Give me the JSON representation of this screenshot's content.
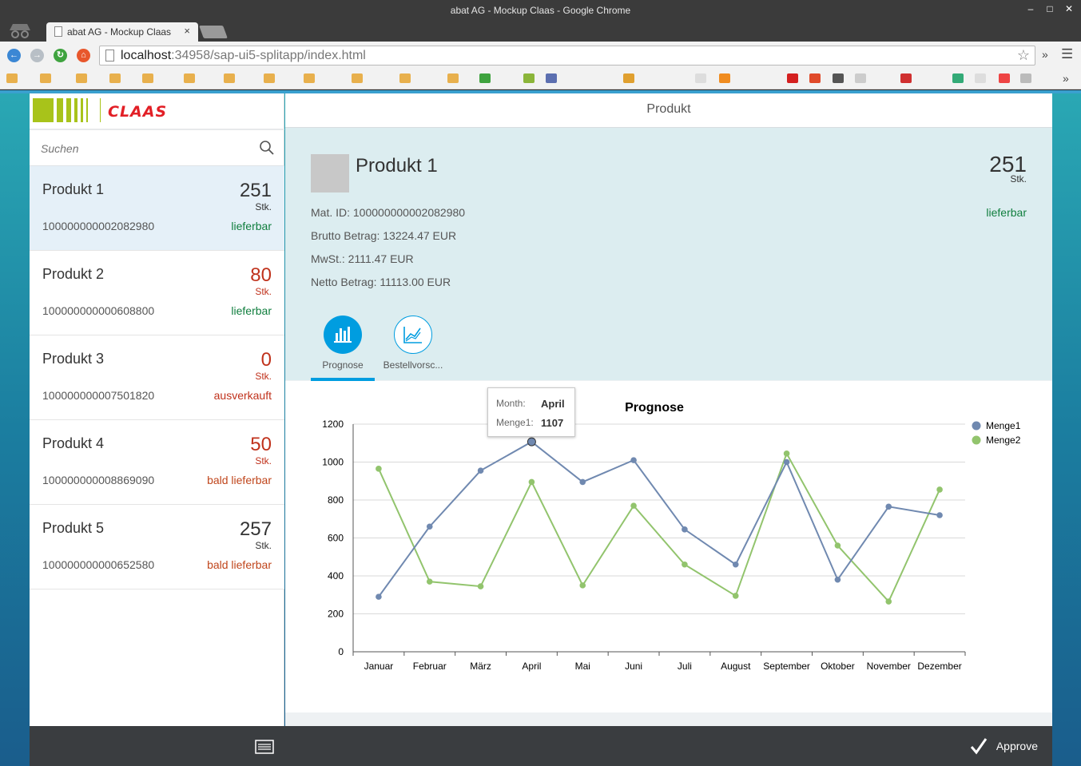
{
  "window": {
    "title": "abat AG - Mockup Claas - Google Chrome",
    "tab_label": "abat AG - Mockup Claas",
    "tab_close": "×"
  },
  "browser": {
    "url_host": "localhost",
    "url_rest": ":34958/sap-ui5-splitapp/index.html",
    "menu_more": "»",
    "bookmarks_more": "»"
  },
  "master": {
    "logo_text": "CLAAS",
    "search_placeholder": "Suchen",
    "items": [
      {
        "name": "Produkt 1",
        "count": "251",
        "unit": "Stk.",
        "id": "100000000002082980",
        "status": "lieferbar",
        "status_color": "#107e3e",
        "count_color": "#333333"
      },
      {
        "name": "Produkt 2",
        "count": "80",
        "unit": "Stk.",
        "id": "100000000000608800",
        "status": "lieferbar",
        "status_color": "#107e3e",
        "count_color": "#c0321c"
      },
      {
        "name": "Produkt 3",
        "count": "0",
        "unit": "Stk.",
        "id": "100000000007501820",
        "status": "ausverkauft",
        "status_color": "#c0321c",
        "count_color": "#c0321c"
      },
      {
        "name": "Produkt 4",
        "count": "50",
        "unit": "Stk.",
        "id": "100000000008869090",
        "status": "bald lieferbar",
        "status_color": "#c0461c",
        "count_color": "#c0321c"
      },
      {
        "name": "Produkt 5",
        "count": "257",
        "unit": "Stk.",
        "id": "100000000000652580",
        "status": "bald lieferbar",
        "status_color": "#c0461c",
        "count_color": "#333333"
      }
    ]
  },
  "detail": {
    "header_title": "Produkt",
    "object": {
      "title": "Produkt 1",
      "number": "251",
      "unit": "Stk.",
      "status": "lieferbar",
      "attributes": [
        "Mat. ID: 100000000002082980",
        "Brutto Betrag: 13224.47 EUR",
        "MwSt.: 2111.47 EUR",
        "Netto Betrag: 11113.00 EUR"
      ]
    },
    "tabs": [
      {
        "label": "Prognose",
        "icon": "bar-chart-icon",
        "selected": true
      },
      {
        "label": "Bestellvorsc...",
        "icon": "line-chart-icon",
        "selected": false
      }
    ]
  },
  "tooltip": {
    "month_key": "Month:",
    "month_val": "April",
    "value_key": "Menge1:",
    "value_val": "1107"
  },
  "footer": {
    "approve_label": "Approve"
  },
  "colors": {
    "menge1": "#7089b0",
    "menge2": "#92c46d",
    "accent": "#009de0"
  },
  "chart_data": {
    "type": "line",
    "title": "Prognose",
    "categories": [
      "Januar",
      "Februar",
      "März",
      "April",
      "Mai",
      "Juni",
      "Juli",
      "August",
      "September",
      "Oktober",
      "November",
      "Dezember"
    ],
    "series": [
      {
        "name": "Menge1",
        "values": [
          290,
          660,
          955,
          1107,
          895,
          1010,
          645,
          460,
          1000,
          380,
          765,
          720
        ]
      },
      {
        "name": "Menge2",
        "values": [
          965,
          370,
          345,
          895,
          350,
          770,
          460,
          295,
          1045,
          560,
          265,
          855
        ]
      }
    ],
    "ylim": [
      0,
      1200
    ],
    "yticks": [
      0,
      200,
      400,
      600,
      800,
      1000,
      1200
    ],
    "grid": true,
    "legend": "right"
  }
}
